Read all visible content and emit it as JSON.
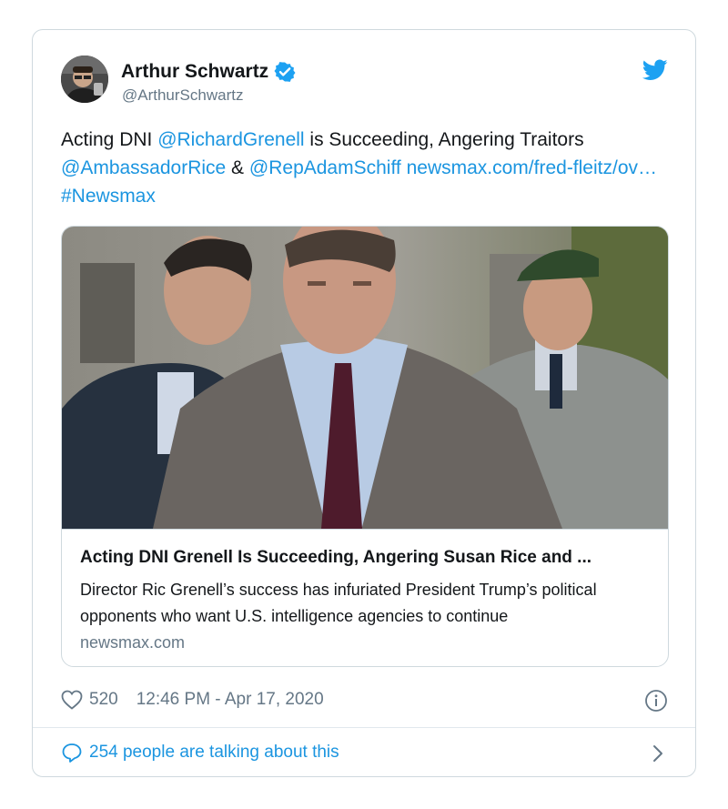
{
  "author": {
    "display_name": "Arthur Schwartz",
    "handle": "@ArthurSchwartz",
    "verified": true
  },
  "tweet": {
    "text_parts": [
      {
        "text": "Acting DNI ",
        "link": false
      },
      {
        "text": "@RichardGrenell",
        "link": true
      },
      {
        "text": " is Succeeding, Angering Traitors ",
        "link": false
      },
      {
        "text": "@AmbassadorRice",
        "link": true
      },
      {
        "text": " & ",
        "link": false
      },
      {
        "text": "@RepAdamSchiff",
        "link": true
      },
      {
        "text": " ",
        "link": false
      },
      {
        "text": "newsmax.com/fred-fleitz/ov…",
        "link": true
      },
      {
        "text": " ",
        "link": false
      },
      {
        "text": "#Newsmax",
        "link": true
      }
    ]
  },
  "link_card": {
    "title": "Acting DNI Grenell Is Succeeding, Angering Susan Rice and ...",
    "description": "Director Ric Grenell’s success has infuriated President Trump’s political opponents who want U.S. intelligence agencies to continue",
    "domain": "newsmax.com"
  },
  "meta": {
    "likes": "520",
    "timestamp": "12:46 PM - Apr 17, 2020"
  },
  "conversation": {
    "label": "254 people are talking about this"
  },
  "icons": {
    "verified": "verified-badge-icon",
    "brand": "twitter-bird-icon",
    "like": "heart-icon",
    "info": "info-icon",
    "reply": "speech-bubble-icon",
    "more": "chevron-right-icon"
  },
  "colors": {
    "link": "#1b95e0",
    "secondary_text": "#657786",
    "border": "#cfd9de"
  }
}
